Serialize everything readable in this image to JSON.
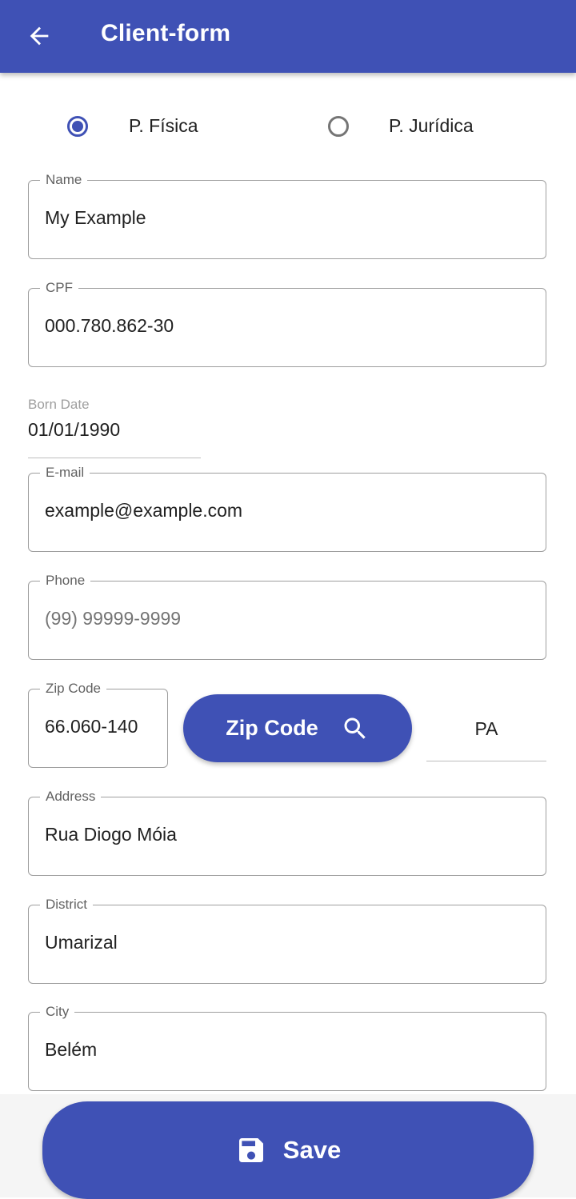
{
  "appbar": {
    "title": "Client-form",
    "back_icon": "arrow-left-icon",
    "color": "#3f51b5"
  },
  "person_type": {
    "options": [
      {
        "label": "P. Física",
        "selected": true
      },
      {
        "label": "P. Jurídica",
        "selected": false
      }
    ]
  },
  "form": {
    "name": {
      "label": "Name",
      "value": "My Example"
    },
    "cpf": {
      "label": "CPF",
      "value": "000.780.862-30"
    },
    "born_date": {
      "label": "Born Date",
      "value": "01/01/1990"
    },
    "email": {
      "label": "E-mail",
      "value": "example@example.com"
    },
    "phone": {
      "label": "Phone",
      "placeholder": "(99) 99999-9999"
    },
    "zip": {
      "label": "Zip Code",
      "value": "66.060-140"
    },
    "zip_search_button": {
      "label": "Zip Code",
      "icon": "search-icon"
    },
    "state": {
      "value": "PA"
    },
    "address": {
      "label": "Address",
      "value": "Rua Diogo Móia"
    },
    "district": {
      "label": "District",
      "value": "Umarizal"
    },
    "city": {
      "label": "City",
      "value": "Belém"
    }
  },
  "save_button": {
    "label": "Save",
    "icon": "floppy-disk-icon"
  }
}
